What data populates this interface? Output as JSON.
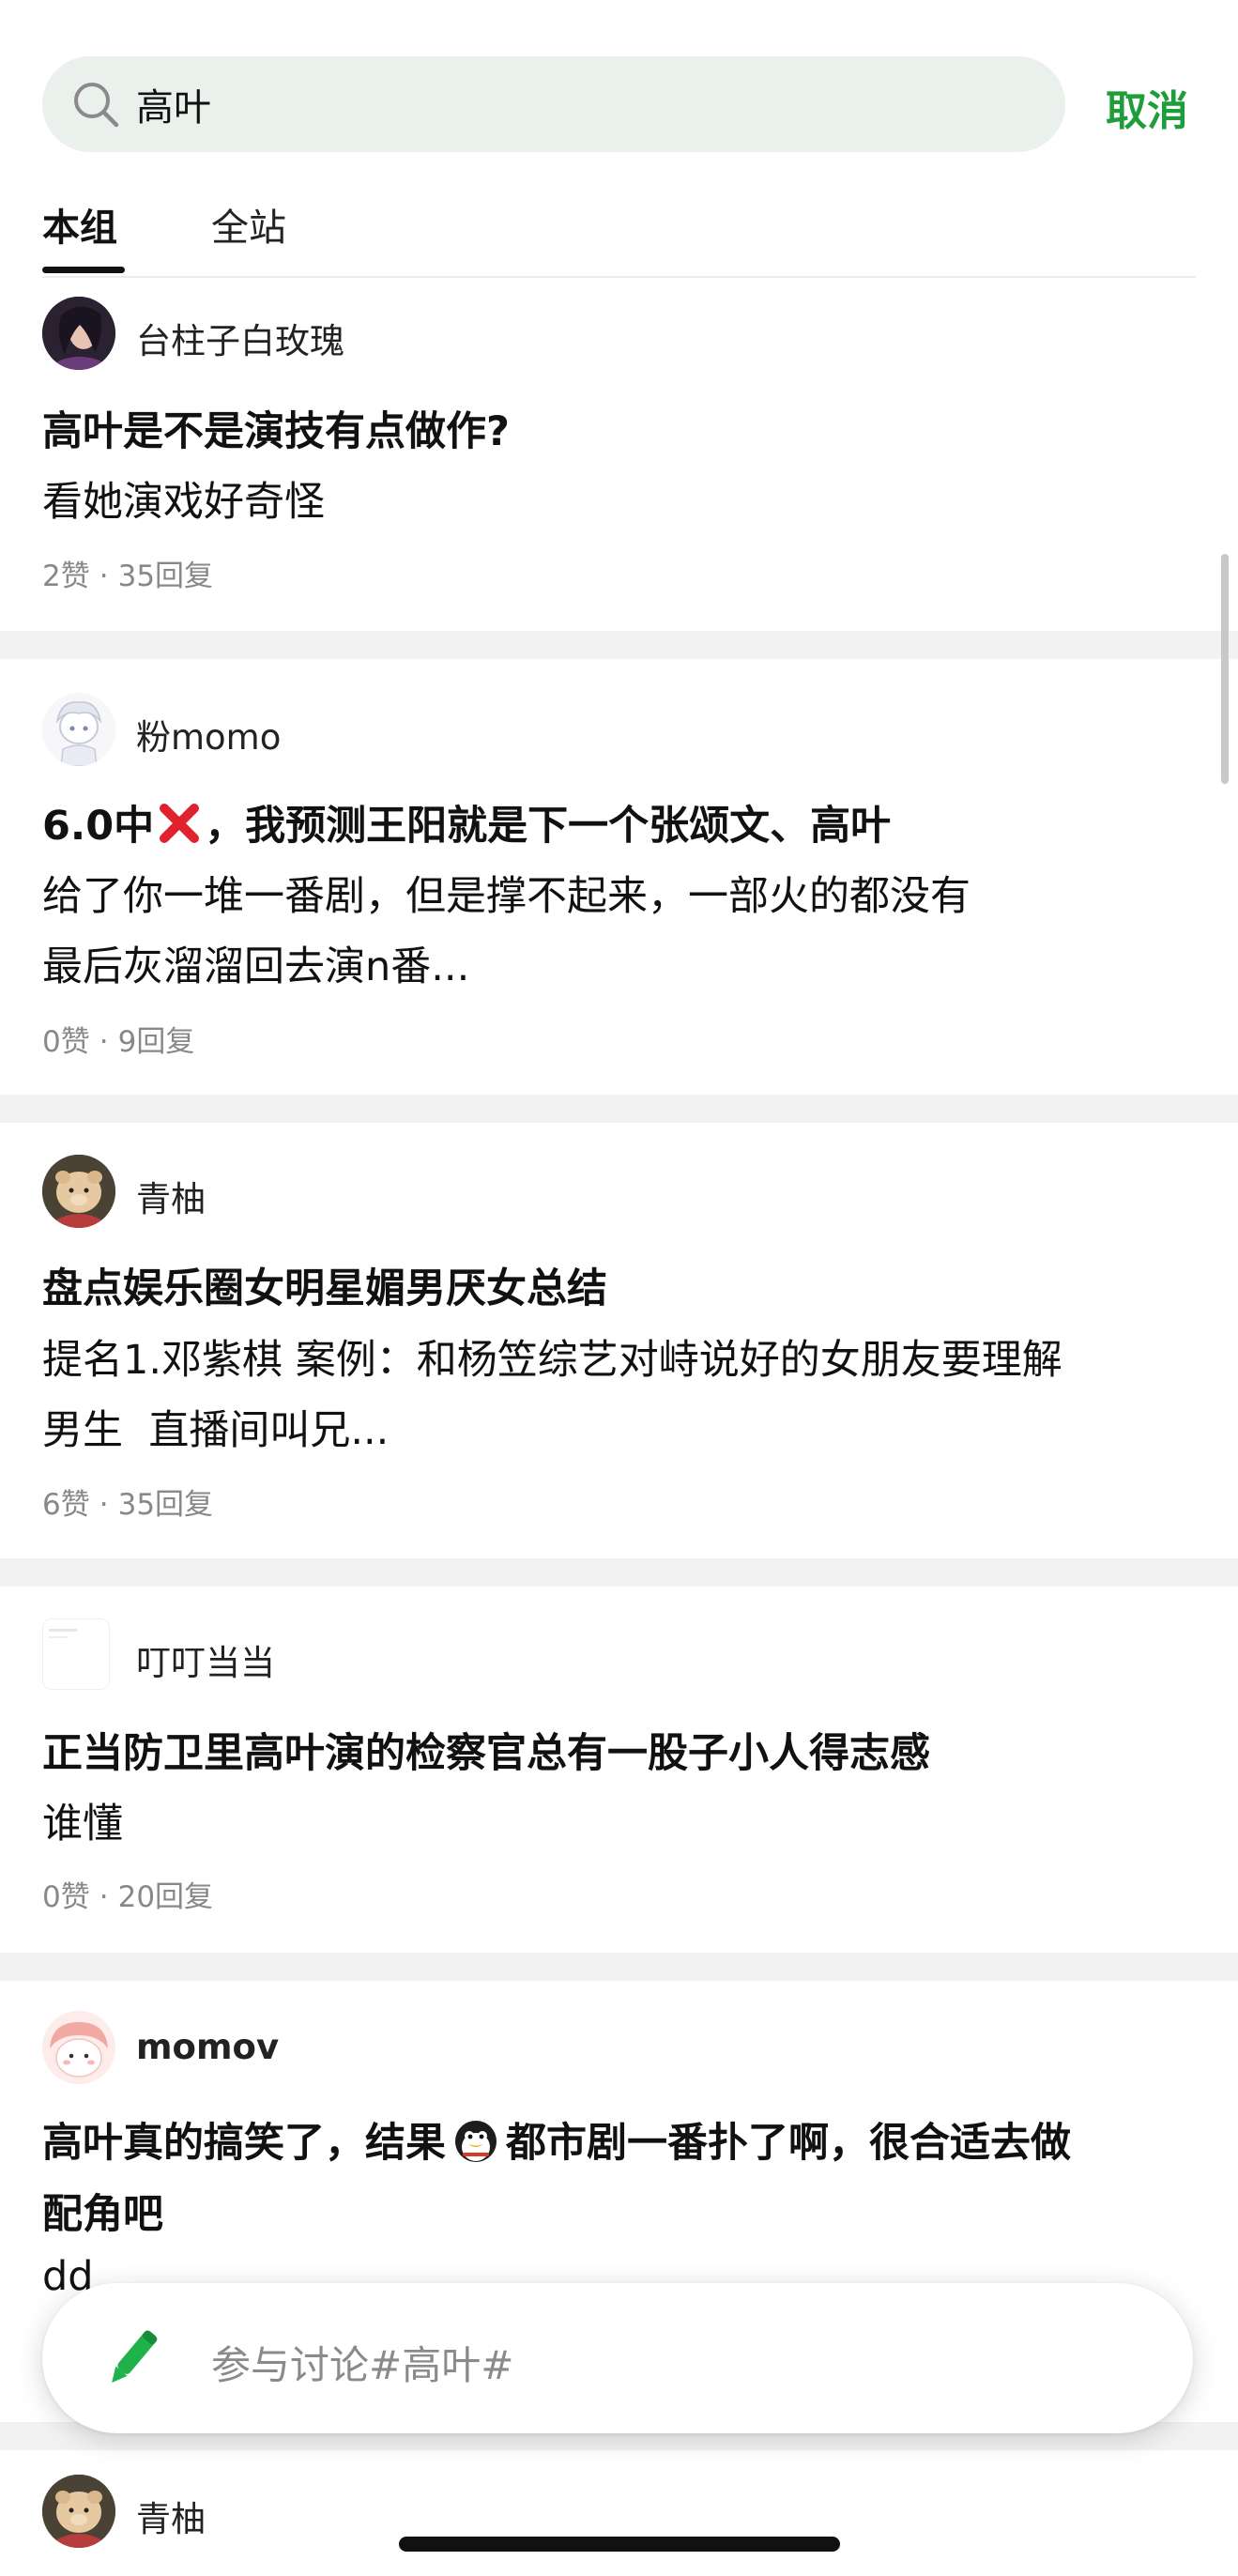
{
  "search": {
    "value": "高叶",
    "cancel_label": "取消"
  },
  "tabs": [
    {
      "label": "本组",
      "active": true
    },
    {
      "label": "全站",
      "active": false
    }
  ],
  "posts": [
    {
      "author": "台柱子白玫瑰",
      "title": "高叶是不是演技有点做作?",
      "body": [
        "看她演戏好奇怪"
      ],
      "likes": "2赞",
      "replies": "35回复"
    },
    {
      "author": "粉momo",
      "title_prefix": "6.0中",
      "title_icon": "red-cross-icon",
      "title_suffix": "，我预测王阳就是下一个张颂文、高叶",
      "body": [
        "给了你一堆一番剧，但是撑不起来，一部火的都没有",
        "最后灰溜溜回去演n番..."
      ],
      "likes": "0赞",
      "replies": "9回复"
    },
    {
      "author": "青柚",
      "title": "盘点娱乐圈女明星媚男厌女总结",
      "body": [
        "提名1.邓紫棋 案例：和杨笠综艺对峙说好的女朋友要理解",
        "男生  直播间叫兄..."
      ],
      "likes": "6赞",
      "replies": "35回复"
    },
    {
      "author": "叮叮当当",
      "title": "正当防卫里高叶演的检察官总有一股子小人得志感",
      "body": [
        "谁懂"
      ],
      "likes": "0赞",
      "replies": "20回复"
    },
    {
      "author": "momov",
      "title_prefix": "高叶真的搞笑了，结果",
      "title_icon": "penguin-icon",
      "title_suffix": "都市剧一番扑了啊，很合适去做",
      "title_line2": "配角吧",
      "body": [
        "dd"
      ]
    },
    {
      "author": "青柚"
    }
  ],
  "composer": {
    "placeholder": "参与讨论#高叶#"
  },
  "meta_separator": "·",
  "colors": {
    "accent_green": "#1f9d3a",
    "search_bg": "#eaf0ec",
    "meta_gray": "#888888",
    "divider_gray": "#f2f2f2"
  }
}
